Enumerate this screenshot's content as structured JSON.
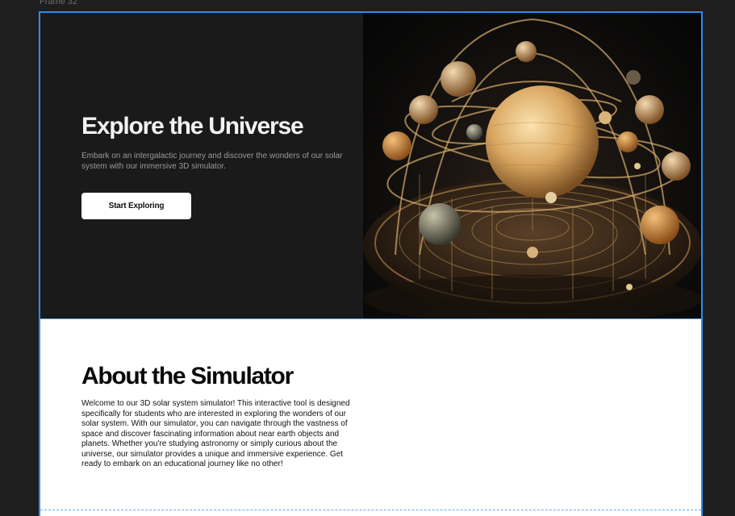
{
  "frame": {
    "label": "Frame 32"
  },
  "hero": {
    "title": "Explore the Universe",
    "description": "Embark on an intergalactic journey and discover the wonders of our solar system with our immersive 3D simulator.",
    "cta_label": "Start Exploring",
    "image_icon": "orrery-illustration"
  },
  "about": {
    "title": "About the Simulator",
    "body": "Welcome to our 3D solar system simulator! This interactive tool is designed specifically for students who are interested in exploring the wonders of our solar system. With our simulator, you can navigate through the vastness of space and discover fascinating information about near earth objects and planets. Whether you're studying astronomy or simply curious about the universe, our simulator provides a unique and immersive experience. Get ready to embark on an educational journey like no other!"
  },
  "colors": {
    "canvas": "#1e1e1e",
    "hero_bg": "#1a1a1a",
    "selection": "#2d8cf0",
    "button_bg": "#ffffff",
    "gold": "#c99a55"
  }
}
